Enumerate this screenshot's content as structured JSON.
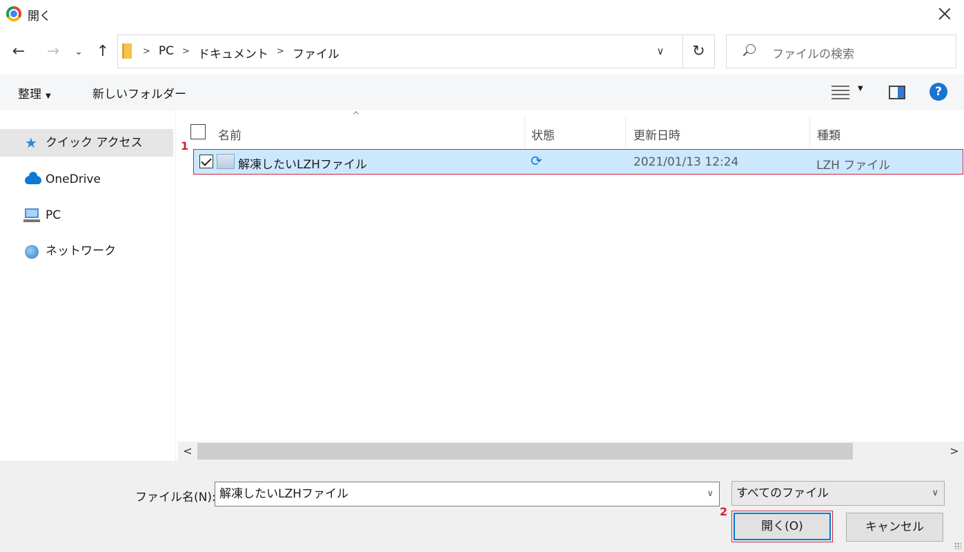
{
  "window": {
    "title": "開く"
  },
  "address": {
    "crumbs": [
      "PC",
      "ドキュメント",
      "ファイル"
    ],
    "search_placeholder": "ファイルの検索"
  },
  "toolbar": {
    "organize": "整理",
    "new_folder": "新しいフォルダー",
    "help": "?"
  },
  "nav": {
    "items": [
      {
        "label": "クイック アクセス",
        "icon": "star-icon",
        "selected": true
      },
      {
        "label": "OneDrive",
        "icon": "cloud-icon"
      },
      {
        "label": "PC",
        "icon": "pc-icon"
      },
      {
        "label": "ネットワーク",
        "icon": "network-icon"
      }
    ]
  },
  "columns": {
    "name": "名前",
    "status": "状態",
    "modified": "更新日時",
    "type": "種類"
  },
  "files": [
    {
      "name": "解凍したいLZHファイル",
      "status_icon": "sync-icon",
      "modified": "2021/01/13 12:24",
      "type": "LZH ファイル",
      "checked": true
    }
  ],
  "annotations": {
    "step1": "1",
    "step2": "2"
  },
  "footer": {
    "filename_label": "ファイル名(N):",
    "filename_value": "解凍したいLZHファイル",
    "filetype_value": "すべてのファイル",
    "open_label": "開く(O)",
    "cancel_label": "キャンセル"
  },
  "colors": {
    "accent": "#0078d7",
    "selection": "#cce8ff",
    "highlight_border": "#d1213a"
  }
}
